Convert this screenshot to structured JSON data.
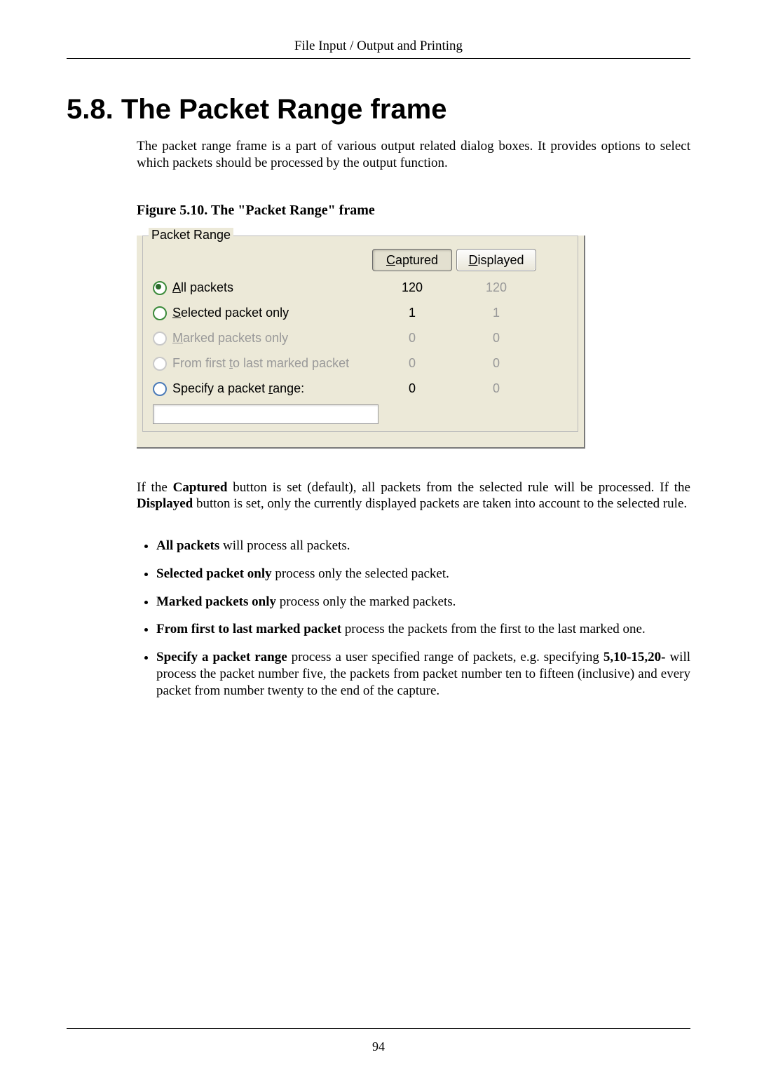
{
  "header": {
    "running_title": "File Input / Output and Printing"
  },
  "section": {
    "number": "5.8.",
    "title": "The Packet Range frame"
  },
  "intro": "The packet range frame is a part of various output related dialog boxes. It provides options to select which packets should be processed by the output function.",
  "figure": {
    "label": "Figure 5.10. The \"Packet Range\" frame"
  },
  "packet_range": {
    "legend": "Packet Range",
    "columns": {
      "captured_html": "<span class='pr-u'>C</span>aptured",
      "displayed_html": "<span class='pr-u'>D</span>isplayed"
    },
    "rows": [
      {
        "key": "all",
        "label_html": "<span class='pr-u'>A</span>ll packets",
        "captured": "120",
        "displayed": "120",
        "selected": true,
        "enabled": true,
        "displayed_disabled": true
      },
      {
        "key": "selected",
        "label_html": "<span class='pr-u'>S</span>elected packet only",
        "captured": "1",
        "displayed": "1",
        "selected": false,
        "enabled": true,
        "displayed_disabled": true
      },
      {
        "key": "marked",
        "label_html": "<span class='pr-u'>M</span>arked packets only",
        "captured": "0",
        "displayed": "0",
        "selected": false,
        "enabled": false,
        "displayed_disabled": true
      },
      {
        "key": "first_to_last",
        "label_html": "From first <span class='pr-u'>t</span>o last marked packet",
        "captured": "0",
        "displayed": "0",
        "selected": false,
        "enabled": false,
        "displayed_disabled": true
      },
      {
        "key": "specify",
        "label_html": "Specify a packet <span class='pr-u'>r</span>ange:",
        "captured": "0",
        "displayed": "0",
        "selected": false,
        "enabled": true,
        "radio_blue": true,
        "displayed_disabled": true
      }
    ],
    "captured_pressed": true,
    "displayed_pressed": false
  },
  "after_para_pre": "If the ",
  "after_para_captured": "Captured",
  "after_para_mid": " button is set (default), all packets from the selected rule will be processed. If the ",
  "after_para_displayed": "Displayed",
  "after_para_post": " button is set, only the currently displayed packets are taken into account to the selected rule.",
  "bullets": [
    {
      "bold": "All packets",
      "rest": " will process all packets."
    },
    {
      "bold": "Selected packet only",
      "rest": " process only the selected packet."
    },
    {
      "bold": "Marked packets only",
      "rest": " process only the marked packets."
    },
    {
      "bold": "From first to last marked packet",
      "rest": " process the packets from the first to the last marked one."
    },
    {
      "bold": "Specify a packet range",
      "rest_pre": " process a user specified range of packets, e.g. specifying ",
      "bold2": "5,10-15,20-",
      "rest_post": " will process the packet number five, the packets from packet number ten to fifteen (inclusive) and every packet from number twenty to the end of the capture."
    }
  ],
  "page_number": "94"
}
